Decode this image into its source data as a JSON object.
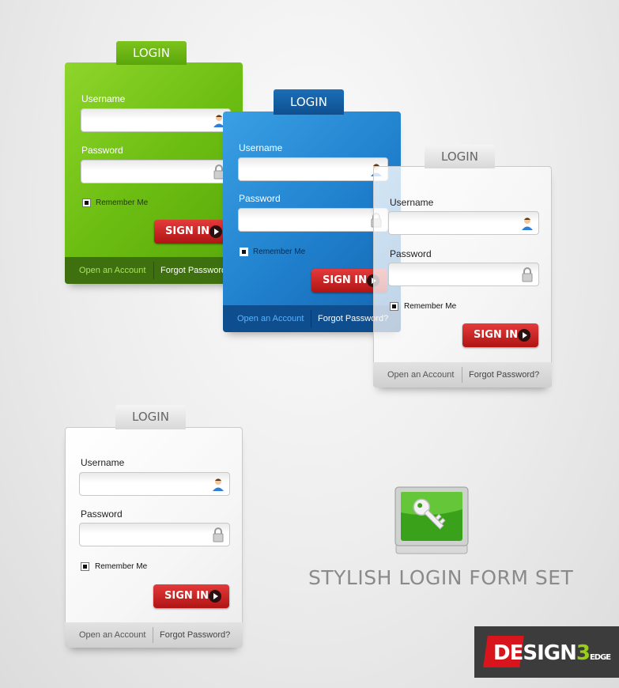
{
  "forms": {
    "green": {
      "tab": "LOGIN",
      "username_label": "Username",
      "password_label": "Password",
      "remember": "Remember Me",
      "signin": "SIGN IN",
      "open_account": "Open an Account",
      "forgot": "Forgot Password"
    },
    "blue": {
      "tab": "LOGIN",
      "username_label": "Username",
      "password_label": "Password",
      "remember": "Remember Me",
      "signin": "SIGN IN",
      "open_account": "Open an Account",
      "forgot": "Forgot Password?"
    },
    "glass": {
      "tab": "LOGIN",
      "username_label": "Username",
      "password_label": "Password",
      "remember": "Remember Me",
      "signin": "SIGN IN",
      "open_account": "Open an Account",
      "forgot": "Forgot Password?"
    },
    "white": {
      "tab": "LOGIN",
      "username_label": "Username",
      "password_label": "Password",
      "remember": "Remember Me",
      "signin": "SIGN IN",
      "open_account": "Open an Account",
      "forgot": "Forgot Password?"
    }
  },
  "set_title": "STYLISH LOGIN FORM SET",
  "watermark": "DESIGN3EDGE",
  "colors": {
    "green": "#6cbd12",
    "blue": "#1f7fcc",
    "red": "#c41e1e",
    "footer_dark": "#3d6d0e"
  }
}
